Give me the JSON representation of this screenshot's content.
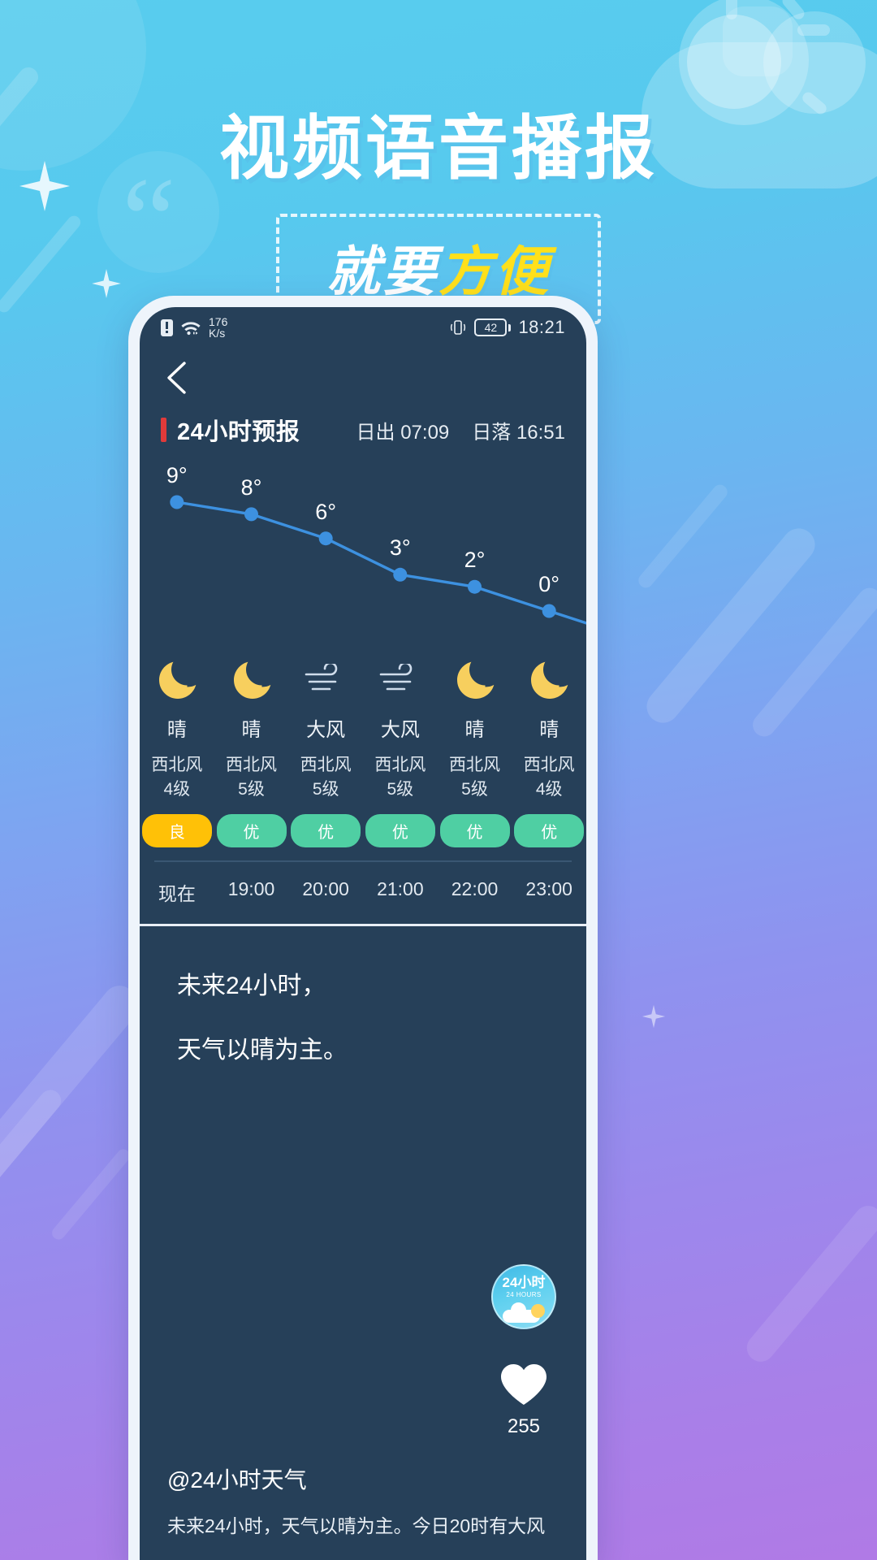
{
  "promo": {
    "title": "视频语音播报",
    "subtitle_white": "就要",
    "subtitle_yellow": "方便"
  },
  "statusbar": {
    "network_speed": "176",
    "network_unit": "K/s",
    "battery_level": "42",
    "clock": "18:21",
    "sim_icon": "sim-card-icon",
    "wifi_icon": "wifi-icon",
    "vibrate_icon": "vibrate-icon",
    "battery_icon": "battery-icon"
  },
  "navbar": {
    "back_icon": "back-chevron-icon"
  },
  "section": {
    "title": "24小时预报",
    "sunrise_label": "日出",
    "sunrise_time": "07:09",
    "sunset_label": "日落",
    "sunset_time": "16:51",
    "accent_color": "#e03a3a"
  },
  "chart_data": {
    "type": "line",
    "title": "24小时预报",
    "xlabel": "",
    "ylabel": "",
    "categories": [
      "现在",
      "19:00",
      "20:00",
      "21:00",
      "22:00",
      "23:00"
    ],
    "values": [
      9,
      8,
      6,
      3,
      2,
      0
    ],
    "value_labels": [
      "9°",
      "8°",
      "6°",
      "3°",
      "2°",
      "0°"
    ],
    "ylim": [
      -1,
      10
    ],
    "grid": false,
    "legend": "none",
    "line_color": "#3d91e0",
    "point_color": "#3d91e0"
  },
  "hours": [
    {
      "time": "现在",
      "icon": "moon-icon",
      "condition": "晴",
      "wind_dir": "西北风",
      "wind_level": "4级",
      "aqi": "良",
      "aqi_class": "liang",
      "temp": "9°"
    },
    {
      "time": "19:00",
      "icon": "moon-icon",
      "condition": "晴",
      "wind_dir": "西北风",
      "wind_level": "5级",
      "aqi": "优",
      "aqi_class": "you",
      "temp": "8°"
    },
    {
      "time": "20:00",
      "icon": "wind-icon",
      "condition": "大风",
      "wind_dir": "西北风",
      "wind_level": "5级",
      "aqi": "优",
      "aqi_class": "you",
      "temp": "6°"
    },
    {
      "time": "21:00",
      "icon": "wind-icon",
      "condition": "大风",
      "wind_dir": "西北风",
      "wind_level": "5级",
      "aqi": "优",
      "aqi_class": "you",
      "temp": "3°"
    },
    {
      "time": "22:00",
      "icon": "moon-icon",
      "condition": "晴",
      "wind_dir": "西北风",
      "wind_level": "5级",
      "aqi": "优",
      "aqi_class": "you",
      "temp": "2°"
    },
    {
      "time": "23:00",
      "icon": "moon-icon",
      "condition": "晴",
      "wind_dir": "西北风",
      "wind_level": "4级",
      "aqi": "优",
      "aqi_class": "you",
      "temp": "0°"
    }
  ],
  "narration": {
    "line1": "未来24小时，",
    "line2": "天气以晴为主。"
  },
  "rail": {
    "badge_title": "24小时",
    "badge_sub": "24 HOURS",
    "like_icon": "heart-icon",
    "like_count": "255"
  },
  "caption": {
    "handle": "@24小时天气",
    "text": "未来24小时，天气以晴为主。今日20时有大风"
  }
}
